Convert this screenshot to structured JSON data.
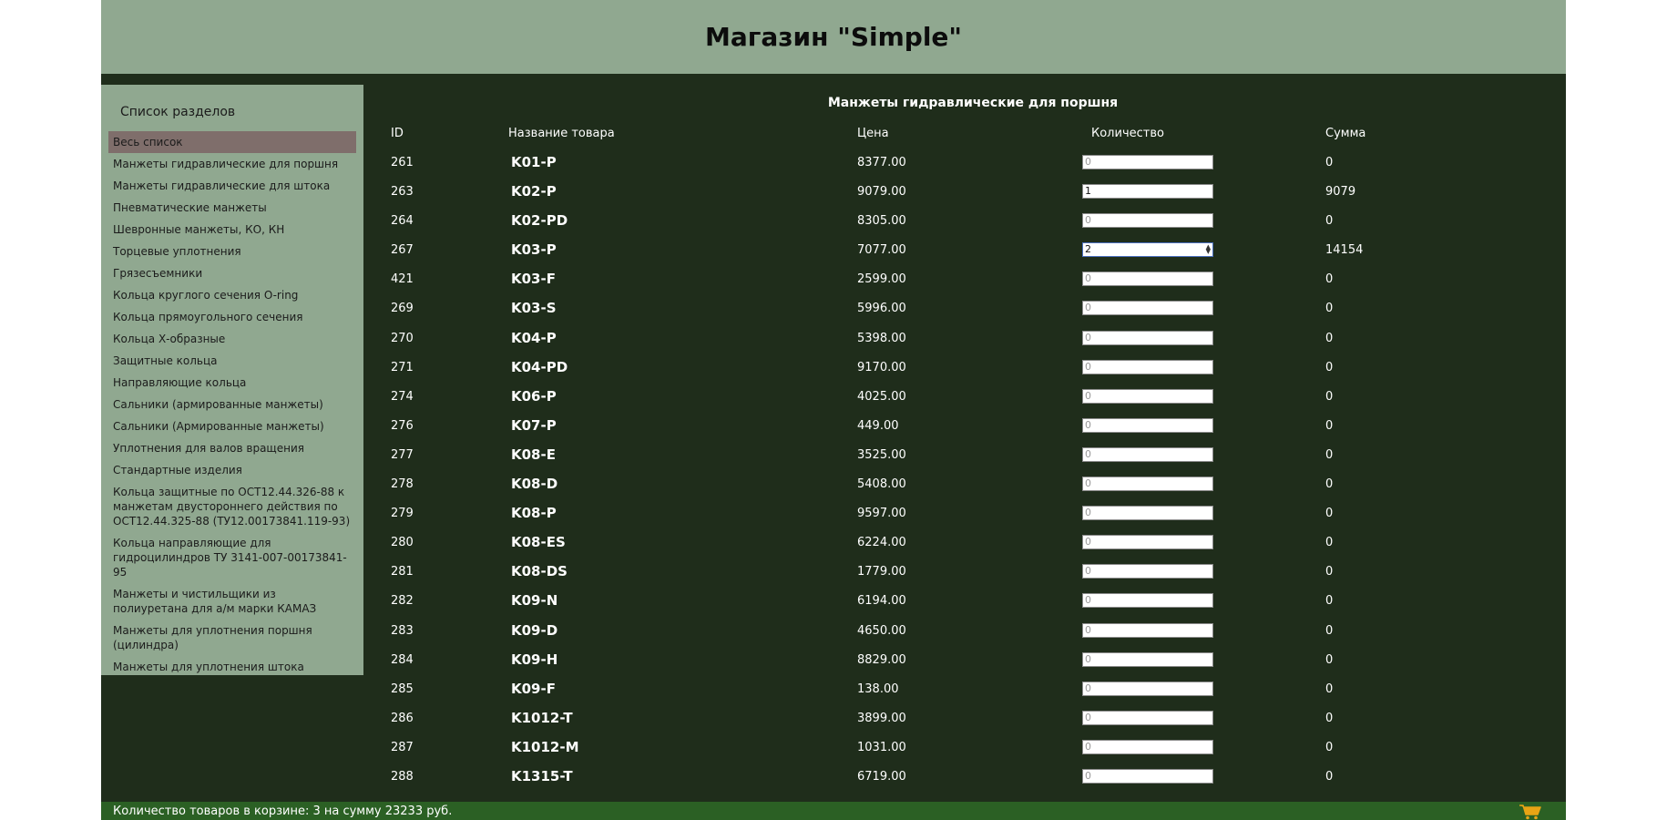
{
  "header": {
    "title": "Магазин \"Simple\""
  },
  "sidebar": {
    "title": "Список разделов",
    "items": [
      "Весь список",
      "Манжеты гидравлические для поршня",
      "Манжеты гидравлические для штока",
      "Пневматические манжеты",
      "Шевронные манжеты, КО, КН",
      "Торцевые уплотнения",
      "Грязесъемники",
      "Кольца круглого сечения O-ring",
      "Кольца прямоугольного сечения",
      "Кольца Х-образные",
      "Защитные кольца",
      "Направляющие кольца",
      "Сальники (армированные манжеты)",
      "Сальники (Армированные манжеты)",
      "Уплотнения для валов вращения",
      "Стандартные изделия",
      "Кольца защитные по ОСТ12.44.326-88 к манжетам двустороннего действия по ОСТ12.44.325-88 (ТУ12.00173841.119-93)",
      "Кольца направляющие для гидроцилиндров ТУ 3141-007-00173841-95",
      "Манжеты и чистильщики из полиуретана для а/м марки КАМАЗ",
      "Манжеты для уплотнения поршня (цилиндра)",
      "Манжеты для уплотнения штока"
    ]
  },
  "main": {
    "section_title": "Манжеты гидравлические для поршня",
    "columns": {
      "id": "ID",
      "name": "Название товара",
      "price": "Цена",
      "qty": "Количество",
      "sum": "Сумма"
    },
    "rows": [
      {
        "id": "261",
        "name": "K01-P",
        "price": "8377.00",
        "qty": "0",
        "sum": "0"
      },
      {
        "id": "263",
        "name": "K02-P",
        "price": "9079.00",
        "qty": "1",
        "sum": "9079"
      },
      {
        "id": "264",
        "name": "K02-PD",
        "price": "8305.00",
        "qty": "0",
        "sum": "0"
      },
      {
        "id": "267",
        "name": "K03-P",
        "price": "7077.00",
        "qty": "2",
        "sum": "14154"
      },
      {
        "id": "421",
        "name": "K03-F",
        "price": "2599.00",
        "qty": "0",
        "sum": "0"
      },
      {
        "id": "269",
        "name": "K03-S",
        "price": "5996.00",
        "qty": "0",
        "sum": "0"
      },
      {
        "id": "270",
        "name": "K04-P",
        "price": "5398.00",
        "qty": "0",
        "sum": "0"
      },
      {
        "id": "271",
        "name": "K04-PD",
        "price": "9170.00",
        "qty": "0",
        "sum": "0"
      },
      {
        "id": "274",
        "name": "K06-P",
        "price": "4025.00",
        "qty": "0",
        "sum": "0"
      },
      {
        "id": "276",
        "name": "K07-P",
        "price": "449.00",
        "qty": "0",
        "sum": "0"
      },
      {
        "id": "277",
        "name": "K08-E",
        "price": "3525.00",
        "qty": "0",
        "sum": "0"
      },
      {
        "id": "278",
        "name": "K08-D",
        "price": "5408.00",
        "qty": "0",
        "sum": "0"
      },
      {
        "id": "279",
        "name": "K08-P",
        "price": "9597.00",
        "qty": "0",
        "sum": "0"
      },
      {
        "id": "280",
        "name": "K08-ES",
        "price": "6224.00",
        "qty": "0",
        "sum": "0"
      },
      {
        "id": "281",
        "name": "K08-DS",
        "price": "1779.00",
        "qty": "0",
        "sum": "0"
      },
      {
        "id": "282",
        "name": "K09-N",
        "price": "6194.00",
        "qty": "0",
        "sum": "0"
      },
      {
        "id": "283",
        "name": "K09-D",
        "price": "4650.00",
        "qty": "0",
        "sum": "0"
      },
      {
        "id": "284",
        "name": "K09-H",
        "price": "8829.00",
        "qty": "0",
        "sum": "0"
      },
      {
        "id": "285",
        "name": "K09-F",
        "price": "138.00",
        "qty": "0",
        "sum": "0"
      },
      {
        "id": "286",
        "name": "K1012-T",
        "price": "3899.00",
        "qty": "0",
        "sum": "0"
      },
      {
        "id": "287",
        "name": "K1012-M",
        "price": "1031.00",
        "qty": "0",
        "sum": "0"
      },
      {
        "id": "288",
        "name": "K1315-T",
        "price": "6719.00",
        "qty": "0",
        "sum": "0"
      }
    ]
  },
  "footer": {
    "cart_text": "Количество товаров в корзине: 3 на сумму 23233 руб.",
    "cart_icon": "cart-icon"
  },
  "colors": {
    "page_bg": "#1f2d1b",
    "header_bg": "#90a890",
    "sidebar_bg": "#90a890",
    "active_item_bg": "#7f6e6b",
    "footer_bg": "#2b6024",
    "cart_icon": "#e8a415"
  }
}
